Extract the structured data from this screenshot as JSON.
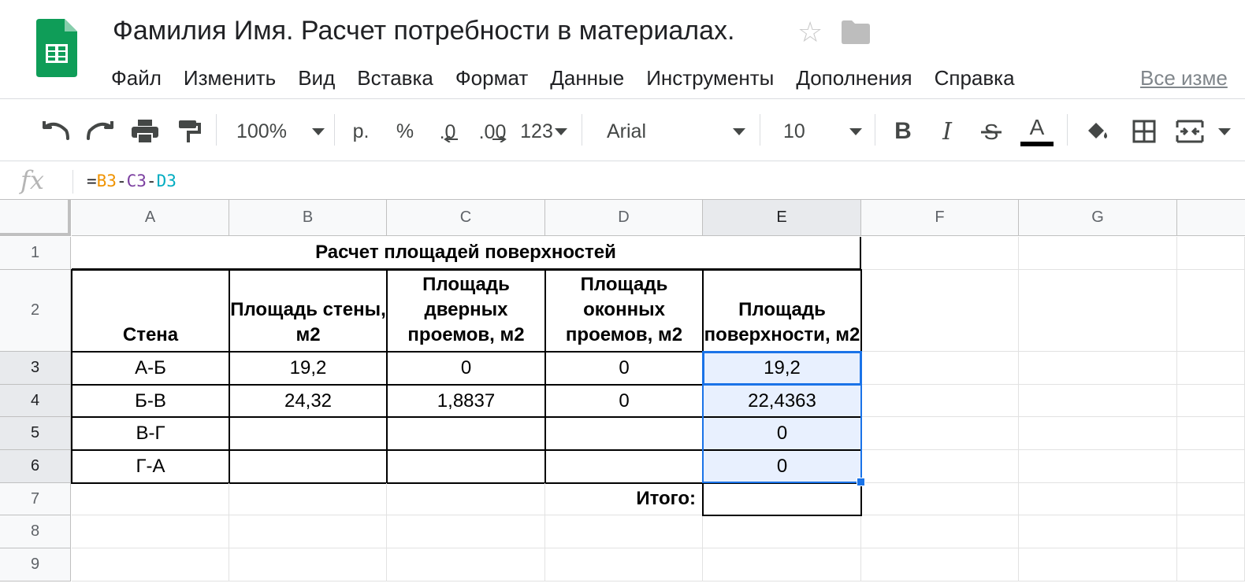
{
  "document": {
    "title": "Фамилия Имя. Расчет потребности в материалах.",
    "star_icon": "☆",
    "all_changes_label": "Все изме"
  },
  "menu": [
    "Файл",
    "Изменить",
    "Вид",
    "Вставка",
    "Формат",
    "Данные",
    "Инструменты",
    "Дополнения",
    "Справка"
  ],
  "toolbar": {
    "zoom": "100%",
    "currency": "р.",
    "percent": "%",
    "decrease_decimal": ".0",
    "increase_decimal": ".00",
    "number_format": "123",
    "font": "Arial",
    "font_size": "10",
    "bold": "B",
    "italic": "I",
    "text_color": "A"
  },
  "formula_bar": {
    "fx_label": "fx",
    "eq": "=",
    "ref1": "B3",
    "op1": "-",
    "ref2": "C3",
    "op2": "-",
    "ref3": "D3",
    "ref1_color": "#f09300",
    "ref2_color": "#7b3fa0",
    "ref3_color": "#00acc1"
  },
  "columns": [
    "A",
    "B",
    "C",
    "D",
    "E",
    "F",
    "G"
  ],
  "rows": [
    "1",
    "2",
    "3",
    "4",
    "5",
    "6",
    "7",
    "8",
    "9"
  ],
  "sheet": {
    "title": "Расчет площадей поверхностей",
    "headers": {
      "a": "Стена",
      "b": "Площадь стены, м2",
      "c": "Площадь дверных проемов, м2",
      "d": "Площадь оконных проемов, м2",
      "e": "Площадь поверхности, м2"
    },
    "data": [
      {
        "wall": "А-Б",
        "area": "19,2",
        "doors": "0",
        "windows": "0",
        "surface": "19,2"
      },
      {
        "wall": "Б-В",
        "area": "24,32",
        "doors": "1,8837",
        "windows": "0",
        "surface": "22,4363"
      },
      {
        "wall": "В-Г",
        "area": "",
        "doors": "",
        "windows": "",
        "surface": "0"
      },
      {
        "wall": "Г-А",
        "area": "",
        "doors": "",
        "windows": "",
        "surface": "0"
      }
    ],
    "total_label": "Итого:",
    "total_value": ""
  },
  "colors": {
    "sheets_green": "#0f9d58",
    "selection_blue": "#1a73e8",
    "selection_fill": "#e8f0fe"
  }
}
